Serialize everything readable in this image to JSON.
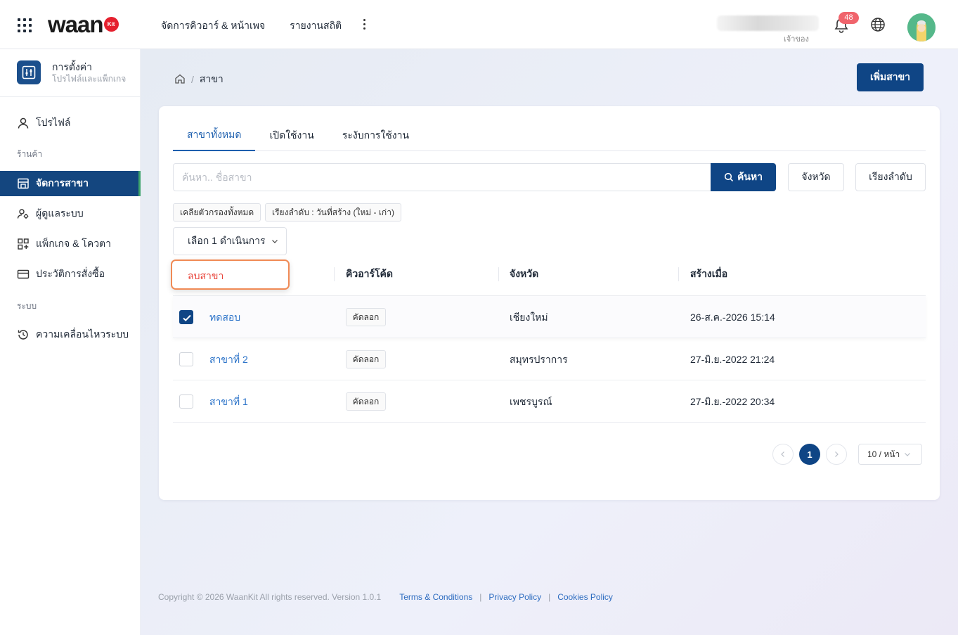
{
  "header": {
    "logo_text": "waan",
    "logo_badge": "Kit",
    "nav": [
      "จัดการคิวอาร์ & หน้าเพจ",
      "รายงานสถิติ"
    ],
    "user_role": "เจ้าของ",
    "notification_count": "48"
  },
  "sidebar": {
    "settings_title": "การตั้งค่า",
    "settings_subtitle": "โปรไฟล์และแพ็กเกจ",
    "profile": "โปรไฟล์",
    "group_store": "ร้านค้า",
    "items": [
      "จัดการสาขา",
      "ผู้ดูแลระบบ",
      "แพ็กเกจ & โควตา",
      "ประวัติการสั่งซื้อ"
    ],
    "group_system": "ระบบ",
    "system_items": [
      "ความเคลื่อนไหวระบบ"
    ]
  },
  "breadcrumb": {
    "current": "สาขา"
  },
  "actions": {
    "add_branch": "เพิ่มสาขา"
  },
  "tabs": [
    "สาขาทั้งหมด",
    "เปิดใช้งาน",
    "ระงับการใช้งาน"
  ],
  "search": {
    "placeholder": "ค้นหา.. ชื่อสาขา",
    "button": "ค้นหา"
  },
  "filters": {
    "province": "จังหวัด",
    "sort": "เรียงลำดับ"
  },
  "chips": [
    "เคลียตัวกรองทั้งหมด",
    "เรียงลำดับ : วันที่สร้าง (ใหม่ - เก่า)"
  ],
  "bulk": {
    "select_label": "เลือก 1 ดำเนินการ",
    "dropdown_item": "ลบสาขา"
  },
  "table": {
    "columns": [
      "คิวอาร์โค้ด",
      "จังหวัด",
      "สร้างเมื่อ"
    ],
    "copy_label": "คัดลอก",
    "rows": [
      {
        "name": "ทดสอบ",
        "province": "เชียงใหม่",
        "created": "26-ส.ค.-2026 15:14",
        "checked": true
      },
      {
        "name": "สาขาที่ 2",
        "province": "สมุทรปราการ",
        "created": "27-มิ.ย.-2022 21:24",
        "checked": false
      },
      {
        "name": "สาขาที่ 1",
        "province": "เพชรบูรณ์",
        "created": "27-มิ.ย.-2022 20:34",
        "checked": false
      }
    ]
  },
  "pagination": {
    "current": "1",
    "page_size": "10 / หน้า"
  },
  "footer": {
    "copyright": "Copyright © 2026 WaanKit All rights reserved. Version 1.0.1",
    "links": [
      "Terms & Conditions",
      "Privacy Policy",
      "Cookies Policy"
    ]
  },
  "colors": {
    "primary": "#0f4585",
    "link": "#2d74c9",
    "danger": "#e8453c",
    "badge": "#f0646c",
    "active_marker": "#3da36b"
  }
}
